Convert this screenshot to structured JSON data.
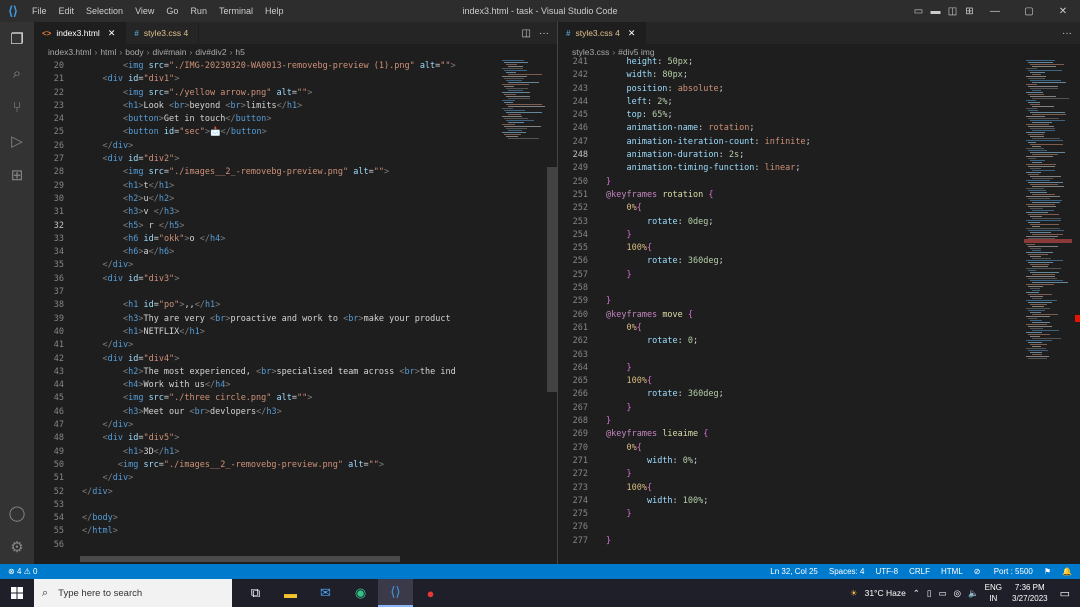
{
  "titlebar": {
    "menu": [
      "File",
      "Edit",
      "Selection",
      "View",
      "Go",
      "Run",
      "Terminal",
      "Help"
    ],
    "title": "index3.html - task - Visual Studio Code"
  },
  "left_editor": {
    "tab_active": "index3.html",
    "tab_inactive": "style3.css 4",
    "breadcrumb": [
      "index3.html",
      "html",
      "body",
      "div#main",
      "div#div2",
      "h5"
    ],
    "current_line": 32,
    "lines": [
      {
        "n": 20,
        "t": "        <img src=\"./IMG-20230320-WA0013-removebg-preview (1).png\" alt=\"\">"
      },
      {
        "n": 21,
        "t": "    <div id=\"div1\">"
      },
      {
        "n": 22,
        "t": "        <img src=\"./yellow arrow.png\" alt=\"\">"
      },
      {
        "n": 23,
        "t": "        <h1>Look <br>beyond <br>limits</h1>"
      },
      {
        "n": 24,
        "t": "        <button>Get in touch</button>"
      },
      {
        "n": 25,
        "t": "        <button id=\"sec\">📩</button>"
      },
      {
        "n": 26,
        "t": "    </div>"
      },
      {
        "n": 27,
        "t": "    <div id=\"div2\">"
      },
      {
        "n": 28,
        "t": "        <img src=\"./images__2_-removebg-preview.png\" alt=\"\">"
      },
      {
        "n": 29,
        "t": "        <h1>t</h1>"
      },
      {
        "n": 30,
        "t": "        <h2>u</h2>"
      },
      {
        "n": 31,
        "t": "        <h3>v </h3>"
      },
      {
        "n": 32,
        "t": "        <h5> r </h5>"
      },
      {
        "n": 33,
        "t": "        <h6 id=\"okk\">o </h4>"
      },
      {
        "n": 34,
        "t": "        <h6>a</h6>"
      },
      {
        "n": 35,
        "t": "    </div>"
      },
      {
        "n": 36,
        "t": "    <div id=\"div3\">"
      },
      {
        "n": 37,
        "t": ""
      },
      {
        "n": 38,
        "t": "        <h1 id=\"po\">,,</h1>"
      },
      {
        "n": 39,
        "t": "        <h3>Thy are very <br>proactive and work to <br>make your product"
      },
      {
        "n": 40,
        "t": "        <h1>NETFLIX</h1>"
      },
      {
        "n": 41,
        "t": "    </div>"
      },
      {
        "n": 42,
        "t": "    <div id=\"div4\">"
      },
      {
        "n": 43,
        "t": "        <h2>The most experienced, <br>specialised team across <br>the ind"
      },
      {
        "n": 44,
        "t": "        <h4>Work with us</h4>"
      },
      {
        "n": 45,
        "t": "        <img src=\"./three circle.png\" alt=\"\">"
      },
      {
        "n": 46,
        "t": "        <h3>Meet our <br>devlopers</h3>"
      },
      {
        "n": 47,
        "t": "    </div>"
      },
      {
        "n": 48,
        "t": "    <div id=\"div5\">"
      },
      {
        "n": 49,
        "t": "        <h1>3D</h1>"
      },
      {
        "n": 50,
        "t": "       <img src=\"./images__2_-removebg-preview.png\" alt=\"\">"
      },
      {
        "n": 51,
        "t": "    </div>"
      },
      {
        "n": 52,
        "t": "</div>"
      },
      {
        "n": 53,
        "t": ""
      },
      {
        "n": 54,
        "t": "</body>"
      },
      {
        "n": 55,
        "t": "</html>"
      },
      {
        "n": 56,
        "t": ""
      }
    ]
  },
  "right_editor": {
    "tab_active": "style3.css 4",
    "breadcrumb": [
      "style3.css",
      "#div5 img"
    ],
    "current_line": 248,
    "lines": [
      {
        "n": 241,
        "t": "    height: 50px;"
      },
      {
        "n": 242,
        "t": "    width: 80px;"
      },
      {
        "n": 243,
        "t": "    position: absolute;"
      },
      {
        "n": 244,
        "t": "    left: 2%;"
      },
      {
        "n": 245,
        "t": "    top: 65%;"
      },
      {
        "n": 246,
        "t": "    animation-name: rotation;"
      },
      {
        "n": 247,
        "t": "    animation-iteration-count: infinite;"
      },
      {
        "n": 248,
        "t": "    animation-duration: 2s;"
      },
      {
        "n": 249,
        "t": "    animation-timing-function: linear;"
      },
      {
        "n": 250,
        "t": "}"
      },
      {
        "n": 251,
        "t": "@keyframes rotation {"
      },
      {
        "n": 252,
        "t": "    0%{"
      },
      {
        "n": 253,
        "t": "        rotate: 0deg;"
      },
      {
        "n": 254,
        "t": "    }"
      },
      {
        "n": 255,
        "t": "    100%{"
      },
      {
        "n": 256,
        "t": "        rotate: 360deg;"
      },
      {
        "n": 257,
        "t": "    }"
      },
      {
        "n": 258,
        "t": ""
      },
      {
        "n": 259,
        "t": "}"
      },
      {
        "n": 260,
        "t": "@keyframes move {"
      },
      {
        "n": 261,
        "t": "    0%{"
      },
      {
        "n": 262,
        "t": "        rotate: 0;"
      },
      {
        "n": 263,
        "t": ""
      },
      {
        "n": 264,
        "t": "    }"
      },
      {
        "n": 265,
        "t": "    100%{"
      },
      {
        "n": 266,
        "t": "        rotate: 360deg;"
      },
      {
        "n": 267,
        "t": "    }"
      },
      {
        "n": 268,
        "t": "}"
      },
      {
        "n": 269,
        "t": "@keyframes lieaime {"
      },
      {
        "n": 270,
        "t": "    0%{"
      },
      {
        "n": 271,
        "t": "        width: 0%;"
      },
      {
        "n": 272,
        "t": "    }"
      },
      {
        "n": 273,
        "t": "    100%{"
      },
      {
        "n": 274,
        "t": "        width: 100%;"
      },
      {
        "n": 275,
        "t": "    }"
      },
      {
        "n": 276,
        "t": ""
      },
      {
        "n": 277,
        "t": "}"
      }
    ]
  },
  "statusbar": {
    "errors": "4",
    "warnings": "0",
    "position": "Ln 32, Col 25",
    "spaces": "Spaces: 4",
    "encoding": "UTF-8",
    "eol": "CRLF",
    "language": "HTML",
    "port": "Port : 5500"
  },
  "taskbar": {
    "search_placeholder": "Type here to search",
    "weather": "31°C  Haze",
    "lang": "ENG",
    "region": "IN",
    "time": "7:36 PM",
    "date": "3/27/2023"
  },
  "colors": {
    "accent": "#007acc",
    "titlebar": "#2d2d2d",
    "editor_bg": "#1e1e1e"
  }
}
